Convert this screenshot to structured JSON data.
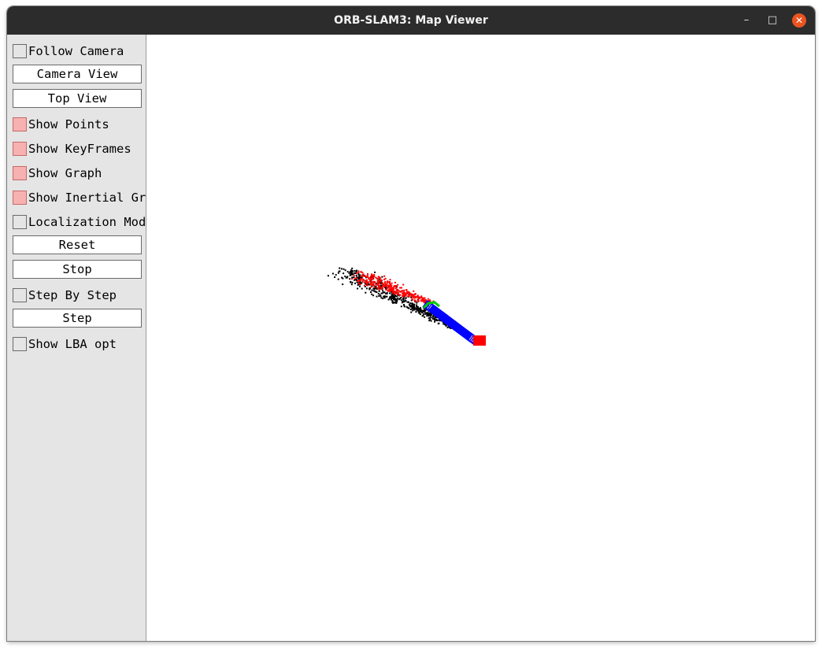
{
  "window": {
    "title": "ORB-SLAM3: Map Viewer",
    "controls": {
      "minimize": "–",
      "maximize": "□",
      "close": "✕"
    }
  },
  "panel": {
    "follow_camera": {
      "label": "Follow Camera",
      "checked": false
    },
    "camera_view": {
      "label": "Camera View"
    },
    "top_view": {
      "label": "Top View"
    },
    "show_points": {
      "label": "Show Points",
      "checked": true
    },
    "show_keyframes": {
      "label": "Show KeyFrames",
      "checked": true
    },
    "show_graph": {
      "label": "Show Graph",
      "checked": true
    },
    "show_inertial_graph": {
      "label": "Show Inertial Graph",
      "checked": true
    },
    "localization_mode": {
      "label": "Localization Mode",
      "checked": false
    },
    "reset": {
      "label": "Reset"
    },
    "stop": {
      "label": "Stop"
    },
    "step_by_step": {
      "label": "Step By Step",
      "checked": false
    },
    "step": {
      "label": "Step"
    },
    "show_lba_opt": {
      "label": "Show LBA opt",
      "checked": false
    }
  },
  "colors": {
    "map_points": "#000000",
    "reference_points": "#ff0000",
    "keyframes": "#0000ff",
    "graph": "#00cc00",
    "current_camera": "#ff0000",
    "checkbox_on": "#f7b1b1"
  }
}
